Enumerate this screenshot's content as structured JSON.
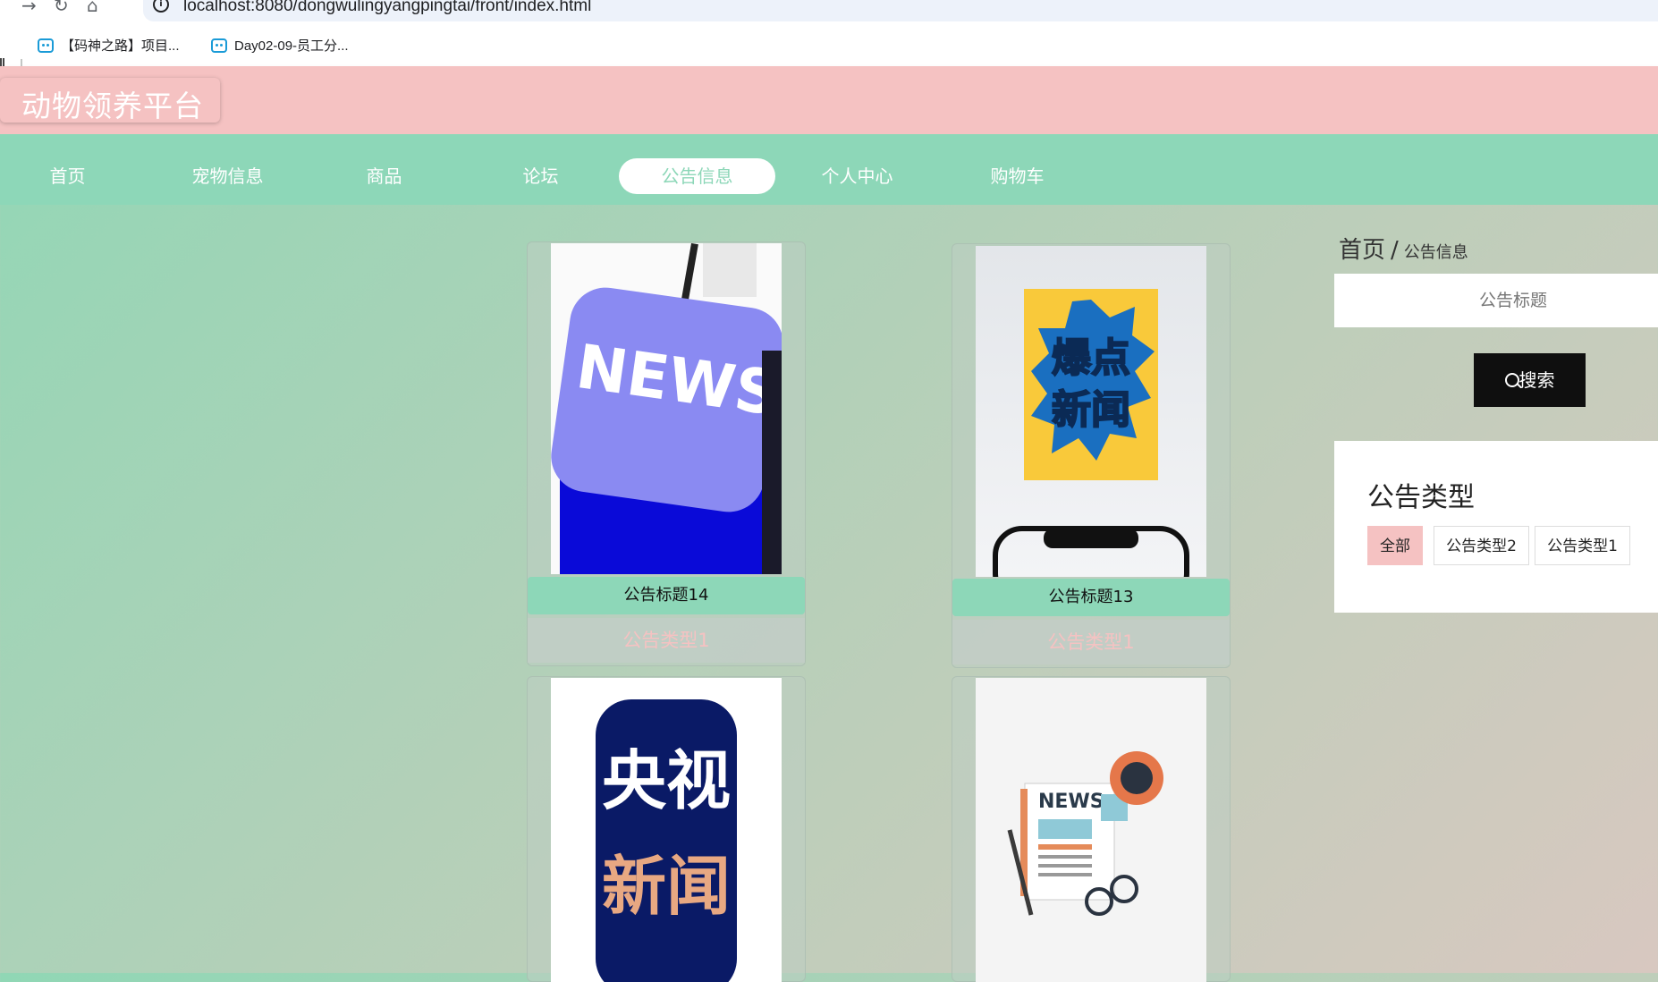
{
  "browser": {
    "address": "localhost:8080/dongwulingyangpingtai/front/index.html",
    "bookmarks": [
      "【码神之路】项目...",
      "Day02-09-员工分..."
    ]
  },
  "header": {
    "title": "动物领养平台"
  },
  "nav": {
    "items": [
      "首页",
      "宠物信息",
      "商品",
      "论坛",
      "公告信息",
      "个人中心",
      "购物车"
    ],
    "active": "公告信息"
  },
  "cards": [
    {
      "title": "公告标题14",
      "type": "公告类型1",
      "image": "news-keyboard-image"
    },
    {
      "title": "公告标题13",
      "type": "公告类型1",
      "image": "breaking-news-phone-image"
    },
    {
      "title": "",
      "type": "",
      "image": "cctv-news-image"
    },
    {
      "title": "",
      "type": "",
      "image": "newspaper-coffee-image"
    }
  ],
  "sidebar": {
    "breadcrumb_home": "首页",
    "breadcrumb_sep": "/",
    "breadcrumb_current": "公告信息",
    "search_placeholder": "公告标题",
    "search_label": "搜索",
    "types_title": "公告类型",
    "types": [
      "全部",
      "公告类型2",
      "公告类型1"
    ],
    "active_type": "全部"
  },
  "colors": {
    "pink": "#f5c2c2",
    "mint": "#8dd7b8",
    "dark": "#0f0f0f"
  }
}
